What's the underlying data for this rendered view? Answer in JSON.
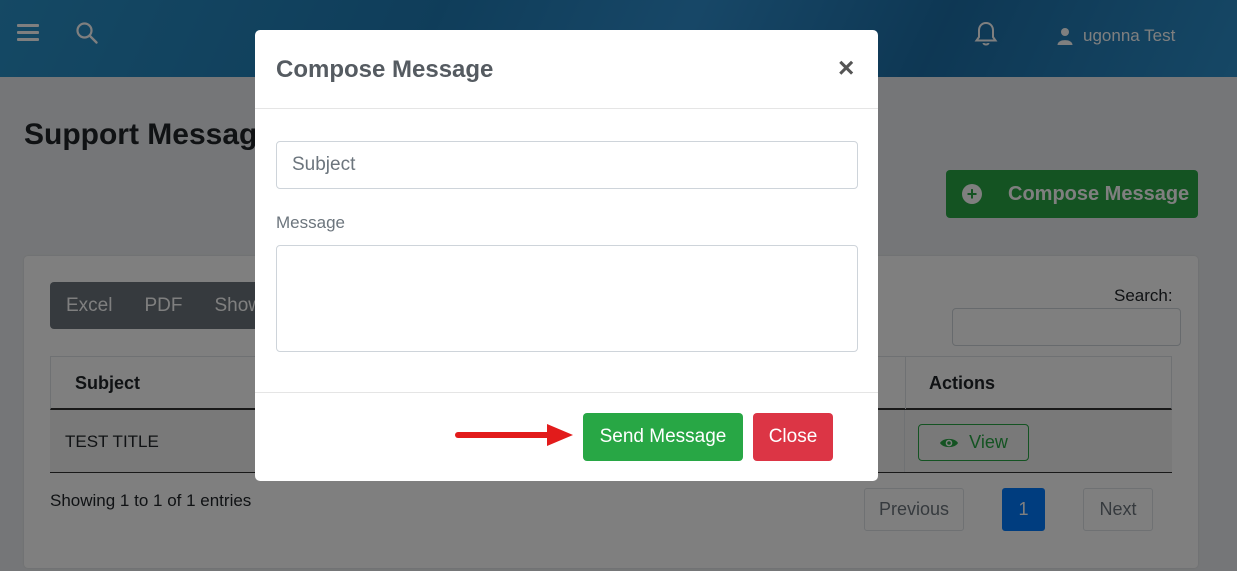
{
  "topbar": {
    "menu_icon": "hamburger-icon",
    "search_icon": "search-icon",
    "notification_icon": "bell-icon",
    "user_icon": "user-icon",
    "user_name": "ugonna Test",
    "background_color": "#1f7bb5"
  },
  "page": {
    "title": "Support Message",
    "compose_button": "Compose Message",
    "compose_icon": "plus-circle-icon"
  },
  "toolbar": {
    "buttons": [
      "Excel",
      "PDF",
      "Show"
    ]
  },
  "search": {
    "label": "Search:",
    "value": ""
  },
  "table": {
    "headers": {
      "subject": "Subject",
      "actions": "Actions"
    },
    "rows": [
      {
        "subject": "TEST TITLE",
        "action_label": "View",
        "action_icon": "eye-icon"
      }
    ]
  },
  "footer": {
    "entries": "Showing 1 to 1 of 1 entries",
    "pagination": {
      "previous": "Previous",
      "current": "1",
      "next": "Next"
    }
  },
  "modal": {
    "title": "Compose Message",
    "close_glyph": "×",
    "subject_placeholder": "Subject",
    "message_label": "Message",
    "message_value": "",
    "send_button": "Send Message",
    "close_button": "Close",
    "annotation": "red-arrow-pointing-at-send"
  },
  "colors": {
    "success": "#28a745",
    "danger": "#dc3545",
    "primary": "#007bff",
    "secondary": "#6c757d",
    "arrow": "#e21b1b"
  }
}
